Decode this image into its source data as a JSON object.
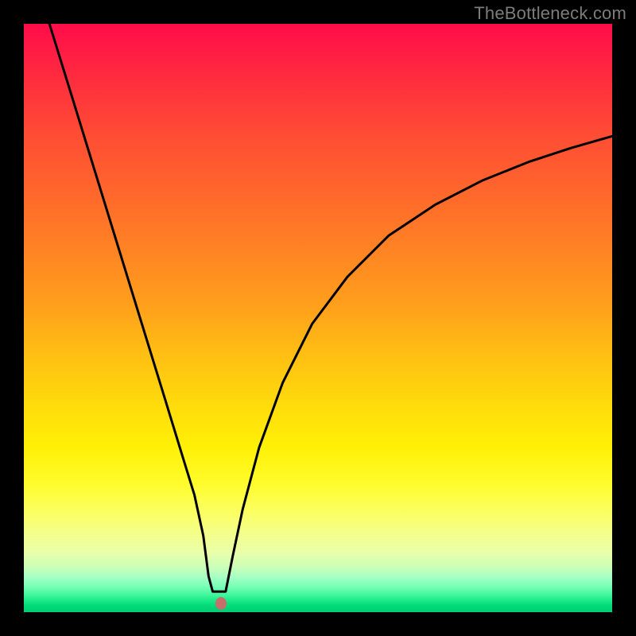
{
  "attribution": "TheBottleneck.com",
  "chart_data": {
    "type": "line",
    "title": "",
    "xlabel": "",
    "ylabel": "",
    "xlim": [
      0,
      1
    ],
    "ylim": [
      0,
      1
    ],
    "background_gradient": [
      "#ff0d4a",
      "#ff652c",
      "#ffd90c",
      "#fbff62",
      "#00cf73"
    ],
    "marker": {
      "x": 0.335,
      "y": 0.985,
      "color": "#c76f6c"
    },
    "series": [
      {
        "name": "left-branch",
        "x": [
          0.0435,
          0.05,
          0.08,
          0.12,
          0.16,
          0.2,
          0.24,
          0.27,
          0.29,
          0.305,
          0.314,
          0.321
        ],
        "y": [
          0.0,
          0.021,
          0.118,
          0.248,
          0.378,
          0.508,
          0.638,
          0.736,
          0.801,
          0.87,
          0.939,
          0.965
        ]
      },
      {
        "name": "flat-bottom",
        "x": [
          0.321,
          0.343
        ],
        "y": [
          0.965,
          0.965
        ]
      },
      {
        "name": "right-branch",
        "x": [
          0.343,
          0.355,
          0.372,
          0.4,
          0.44,
          0.49,
          0.55,
          0.62,
          0.7,
          0.78,
          0.86,
          0.93,
          1.0
        ],
        "y": [
          0.965,
          0.905,
          0.825,
          0.72,
          0.61,
          0.51,
          0.43,
          0.36,
          0.307,
          0.266,
          0.234,
          0.211,
          0.191
        ]
      }
    ]
  }
}
